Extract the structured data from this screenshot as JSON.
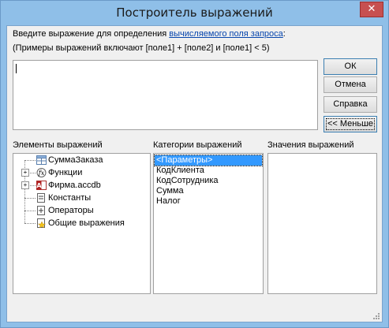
{
  "window": {
    "title": "Построитель выражений",
    "close_glyph": "✕"
  },
  "prompt": {
    "text_before": "Введите выражение для определения ",
    "link": "вычисляемого поля запроса",
    "text_after": ":",
    "example": "(Примеры выражений включают [поле1] + [поле2] и [поле1] < 5)"
  },
  "expression_input": {
    "value": ""
  },
  "buttons": {
    "ok": "ОК",
    "cancel": "Отмена",
    "help": "Справка",
    "less": "<< Меньше"
  },
  "panels": {
    "elements_label": "Элементы выражений",
    "categories_label": "Категории выражений",
    "values_label": "Значения выражений"
  },
  "elements_tree": [
    {
      "label": "СуммаЗаказа",
      "icon": "query-icon",
      "expandable": false
    },
    {
      "label": "Функции",
      "icon": "function-icon",
      "expandable": true
    },
    {
      "label": "Фирма.accdb",
      "icon": "access-db-icon",
      "expandable": true
    },
    {
      "label": "Константы",
      "icon": "constants-icon",
      "expandable": false
    },
    {
      "label": "Операторы",
      "icon": "operators-icon",
      "expandable": false
    },
    {
      "label": "Общие выражения",
      "icon": "common-expressions-icon",
      "expandable": false
    }
  ],
  "categories": [
    {
      "label": "<Параметры>",
      "selected": true
    },
    {
      "label": "КодКлиента",
      "selected": false
    },
    {
      "label": "КодСотрудника",
      "selected": false
    },
    {
      "label": "Сумма",
      "selected": false
    },
    {
      "label": "Налог",
      "selected": false
    }
  ],
  "values": []
}
